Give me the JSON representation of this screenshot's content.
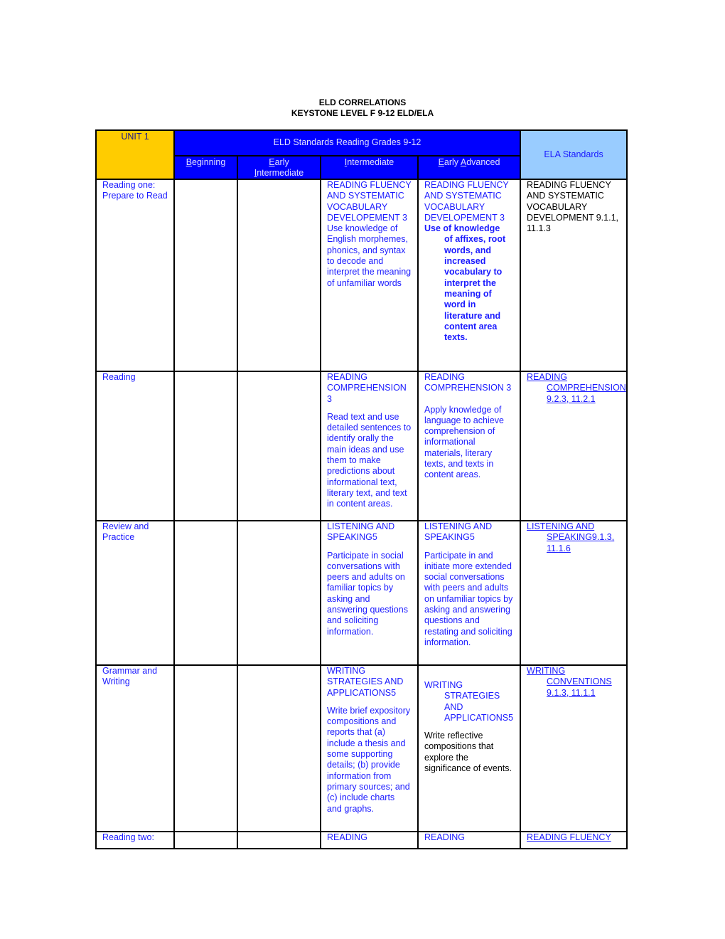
{
  "document": {
    "title_line1": "ELD CORRELATIONS",
    "title_line2": "KEYSTONE LEVEL F 9-12 ELD/ELA"
  },
  "header": {
    "unit": "UNIT 1",
    "eld": "ELD Standards Reading  Grades 9-12",
    "ela": "ELA Standards",
    "levels": {
      "beginning_key": "B",
      "beginning_rest": "eginning",
      "early_int_key": "E",
      "early_int_rest": "arly",
      "early_int_key2": "I",
      "early_int_rest2": "ntermediate",
      "intermediate_key": "I",
      "intermediate_rest": "ntermediate",
      "early_adv_key": "E",
      "early_adv_mid": "arly ",
      "early_adv_key2": "A",
      "early_adv_rest": "dvanced"
    }
  },
  "rows": [
    {
      "lesson": "Reading one: Prepare to Read",
      "beginning": "",
      "early_intermediate": "",
      "intermediate_title": "READING FLUENCY AND SYSTEMATIC VOCABULARY DEVELOPEMENT 3",
      "intermediate_body": "Use knowledge of English morphemes, phonics, and syntax to decode and interpret the meaning of unfamiliar words",
      "early_advanced_title": "READING FLUENCY AND SYSTEMATIC VOCABULARY DEVELOPEMENT 3",
      "early_advanced_body_lead": "Use of knowledge",
      "early_advanced_body": "of affixes, root words, and increased vocabulary to interpret the meaning of word in literature and content area texts.",
      "ela_lead": "READING FLUENCY AND SYSTEMATIC VOCABULARY DEVELOPMENT 9.1.1, 11.1.3"
    },
    {
      "lesson": "Reading",
      "beginning": "",
      "early_intermediate": "",
      "intermediate_title": "READING COMPREHENSION 3",
      "intermediate_body": "Read text and use detailed sentences to identify orally the main ideas and use them to make predictions about informational text, literary text, and text in content areas.",
      "early_advanced_title": "READING COMPREHENSION 3",
      "early_advanced_body": "Apply knowledge of language to achieve comprehension of informational materials, literary texts, and texts in content areas.",
      "ela_lead": "READING ",
      "ela_rest": "COMPREHENSION 9.2.3, 11.2.1"
    },
    {
      "lesson": "Review and Practice",
      "beginning": "",
      "early_intermediate": "",
      "intermediate_title": "LISTENING AND SPEAKING5",
      "intermediate_body": "Participate in social conversations with peers and adults on familiar topics by asking and answering questions and soliciting information.",
      "early_advanced_title": "LISTENING AND SPEAKING5",
      "early_advanced_body": "Participate in and initiate more extended social conversations with peers and adults on unfamiliar topics by asking and answering questions and restating and soliciting information.",
      "ela_lead": "LISTENING AND ",
      "ela_rest": "SPEAKING9.1.3, 11.1.6"
    },
    {
      "lesson": "Grammar and Writing",
      "beginning": "",
      "early_intermediate": "",
      "intermediate_title": "WRITING STRATEGIES AND APPLICATIONS5",
      "intermediate_body": "Write brief expository compositions and reports that (a) include a thesis and some supporting details; (b) provide information from primary sources; and (c) include charts and graphs.",
      "early_advanced_title_lead": "WRITING",
      "early_advanced_title": "STRATEGIES AND APPLICATIONS5",
      "early_advanced_body": "Write reflective compositions that explore the significance of events.",
      "ela_lead": "WRITING ",
      "ela_rest": "CONVENTIONS 9.1.3, 11.1.1"
    },
    {
      "lesson": "Reading two:",
      "beginning": "",
      "early_intermediate": "",
      "intermediate_title": "READING",
      "early_advanced_title": "READING",
      "ela_lead": "READING FLUENCY "
    }
  ]
}
